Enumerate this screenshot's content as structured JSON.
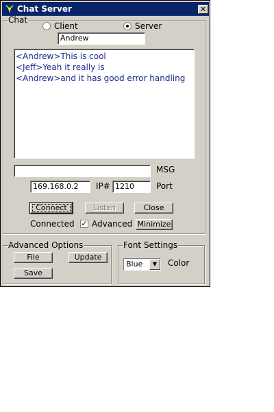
{
  "window": {
    "title": "Chat Server",
    "close_glyph": "✕"
  },
  "chat_group": {
    "legend": "Chat",
    "mode": {
      "client_label": "Client",
      "server_label": "Server",
      "selected": "Server"
    },
    "name_value": "Andrew",
    "messages": [
      "<Andrew>This is cool",
      "<Jeff>Yeah it really is",
      "<Andrew>and it has good error handling"
    ],
    "msg_value": "",
    "msg_label": "MSG",
    "ip_value": "169.168.0.2",
    "ip_label": "IP#",
    "port_value": "1210",
    "port_label": "Port",
    "connect_label": "Connect",
    "listen_label": "Listen",
    "close_label": "Close",
    "status_text": "Connected",
    "advanced_label": "Advanced",
    "advanced_checked": true,
    "minimize_label": "Minimize"
  },
  "advanced_options": {
    "legend": "Advanced Options",
    "file_label": "File",
    "update_label": "Update",
    "save_label": "Save"
  },
  "font_settings": {
    "legend": "Font Settings",
    "color_value": "Blue",
    "color_label": "Color"
  },
  "colors": {
    "title_bar": "#0a246a",
    "message_text": "#1c2a8c",
    "face": "#d4d0c8"
  },
  "icons": {
    "app": "app-icon",
    "close": "close-icon",
    "dropdown": "chevron-down-icon",
    "check": "check-icon"
  }
}
